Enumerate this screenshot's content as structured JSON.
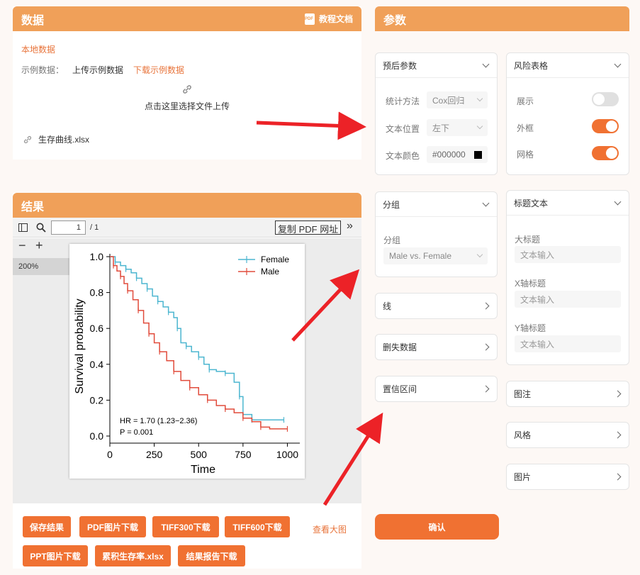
{
  "data_panel": {
    "title": "数据",
    "tutorial": "教程文档",
    "local_data": "本地数据",
    "example_label": "示例数据：",
    "upload_example": "上传示例数据",
    "download_example": "下载示例数据",
    "upload_prompt": "点击这里选择文件上传",
    "file_name": "生存曲线.xlsx"
  },
  "result_panel": {
    "title": "结果",
    "page_current": "1",
    "page_total": "/ 1",
    "copy_url": "复制 PDF 网址",
    "zoom": "200%",
    "view_large": "查看大图",
    "buttons": [
      "保存结果",
      "PDF图片下载",
      "TIFF300下载",
      "TIFF600下载",
      "PPT图片下载",
      "累积生存率.xlsx",
      "结果报告下载"
    ]
  },
  "params": {
    "title": "参数",
    "prognosis": {
      "title": "预后参数",
      "method_label": "统计方法",
      "method_value": "Cox回归",
      "pos_label": "文本位置",
      "pos_value": "左下",
      "color_label": "文本颜色",
      "color_value": "#000000"
    },
    "risk_table": {
      "title": "风险表格",
      "show_label": "展示",
      "show": false,
      "frame_label": "外框",
      "frame": true,
      "grid_label": "网格",
      "grid": true
    },
    "group": {
      "title": "分组",
      "label": "分组",
      "value": "Male vs. Female"
    },
    "title_text": {
      "title": "标题文本",
      "main_label": "大标题",
      "x_label": "X轴标题",
      "y_label": "Y轴标题",
      "placeholder": "文本输入"
    },
    "line": "线",
    "censor": "删失数据",
    "ci": "置信区间",
    "legend": "图注",
    "style": "风格",
    "image": "图片",
    "confirm": "确认"
  },
  "chart_data": {
    "type": "line",
    "xlabel": "Time",
    "ylabel": "Survival probability",
    "xlim": [
      0,
      1050
    ],
    "ylim": [
      0,
      1.0
    ],
    "xticks": [
      "0",
      "250",
      "500",
      "750",
      "1000"
    ],
    "yticks": [
      "0.0",
      "0.2",
      "0.4",
      "0.6",
      "0.8",
      "1.0"
    ],
    "annotations": [
      "HR = 1.70 (1.23−2.36)",
      "P = 0.001"
    ],
    "series": [
      {
        "name": "Female",
        "color": "#4cb6d0",
        "x": [
          0,
          30,
          60,
          90,
          120,
          150,
          180,
          210,
          240,
          270,
          300,
          330,
          360,
          380,
          400,
          430,
          460,
          500,
          530,
          560,
          600,
          650,
          700,
          730,
          750,
          800,
          900,
          980
        ],
        "y": [
          1.0,
          0.97,
          0.95,
          0.93,
          0.91,
          0.88,
          0.85,
          0.82,
          0.78,
          0.75,
          0.72,
          0.69,
          0.66,
          0.6,
          0.52,
          0.5,
          0.47,
          0.44,
          0.4,
          0.37,
          0.36,
          0.35,
          0.3,
          0.22,
          0.12,
          0.09,
          0.09,
          0.09
        ]
      },
      {
        "name": "Male",
        "color": "#e14b3b",
        "x": [
          0,
          20,
          40,
          60,
          80,
          100,
          130,
          160,
          190,
          220,
          250,
          280,
          320,
          360,
          400,
          450,
          500,
          550,
          600,
          650,
          700,
          750,
          800,
          850,
          900,
          1000
        ],
        "y": [
          1.0,
          0.95,
          0.92,
          0.89,
          0.85,
          0.81,
          0.76,
          0.7,
          0.63,
          0.57,
          0.52,
          0.47,
          0.42,
          0.36,
          0.31,
          0.27,
          0.23,
          0.2,
          0.17,
          0.15,
          0.13,
          0.1,
          0.08,
          0.05,
          0.04,
          0.04
        ]
      }
    ]
  }
}
